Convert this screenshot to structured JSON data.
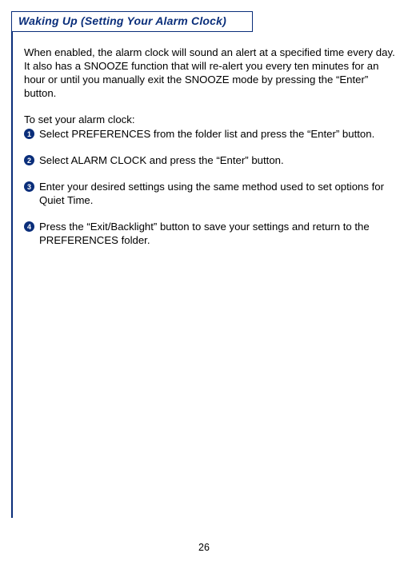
{
  "header": {
    "title": "Waking Up (Setting Your Alarm Clock)"
  },
  "intro": "When enabled, the alarm clock will sound an alert at a specified time every day.  It also has a SNOOZE function that will re-alert you every ten minutes for an hour or until you manually exit the SNOOZE mode by pressing the “Enter” button.",
  "lead_in": "To set your alarm clock:",
  "steps": [
    "Select PREFERENCES from the folder list and press the “Enter” button.",
    "Select ALARM CLOCK and press the “Enter” button.",
    "Enter your desired settings using the same method used to set options for Quiet Time.",
    "Press the “Exit/Backlight” button to save your settings and return to the PREFERENCES folder."
  ],
  "page_number": "26"
}
